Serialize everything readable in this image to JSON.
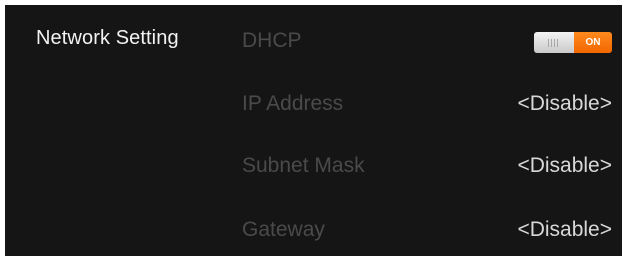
{
  "network": {
    "section_title": "Network Setting",
    "rows": [
      {
        "label": "DHCP",
        "toggle": {
          "state": "on",
          "label": "ON",
          "accent": "#f26700"
        }
      },
      {
        "label": "IP Address",
        "value": "<Disable>"
      },
      {
        "label": "Subnet Mask",
        "value": "<Disable>"
      },
      {
        "label": "Gateway",
        "value": "<Disable>"
      }
    ]
  }
}
